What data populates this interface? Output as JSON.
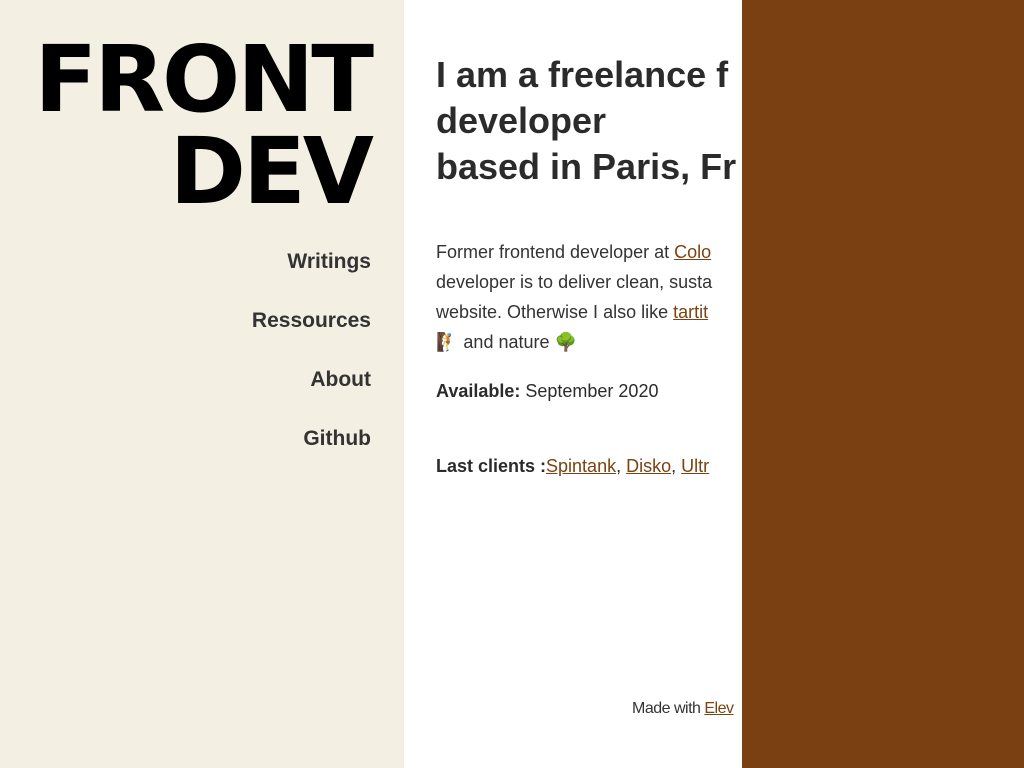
{
  "logo": {
    "line1": "FRONT",
    "line2": "DEV"
  },
  "nav": {
    "items": [
      "Writings",
      "Ressources",
      "About",
      "Github"
    ]
  },
  "headline": {
    "line1": "I am a freelance f",
    "line2": "developer",
    "line3": "based in Paris, Fr"
  },
  "bio": {
    "line1_text": "Former frontend developer at ",
    "line1_link": "Colo",
    "line2_text": "developer is to deliver clean, susta",
    "line3_text": "website. Otherwise I also like ",
    "line3_link": "tartit",
    "line4_emoji1": "🧗",
    "line4_text": " and nature ",
    "line4_emoji2": "🌳"
  },
  "available": {
    "label": "Available:",
    "value": " September 2020"
  },
  "clients": {
    "label": "Last clients :",
    "items": [
      "Spintank",
      "Disko",
      "Ultr"
    ],
    "separator": ", "
  },
  "footer": {
    "text": "Made with ",
    "link": "Elev"
  },
  "colors": {
    "sidebar_bg": "#f4efe3",
    "link": "#7a4311",
    "overlay": "#7a4011"
  }
}
